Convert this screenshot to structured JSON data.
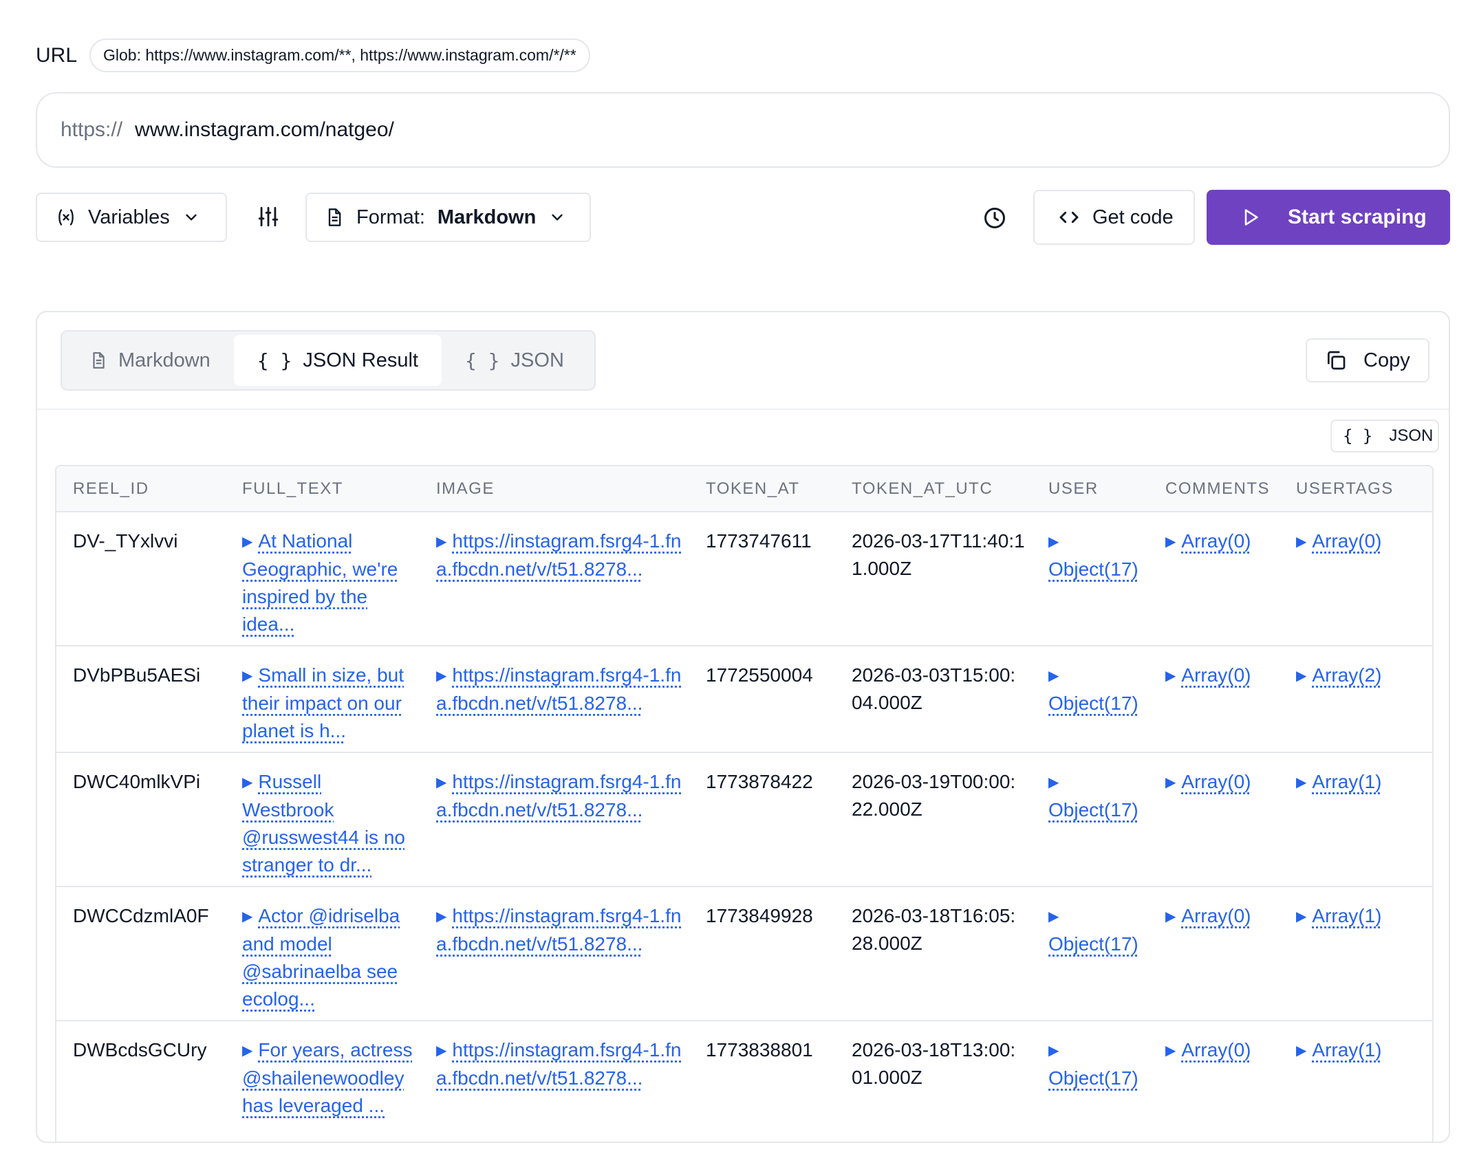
{
  "url_section": {
    "label": "URL",
    "glob": "Glob: https://www.instagram.com/**, https://www.instagram.com/*/**",
    "prefix": "https://",
    "value": "www.instagram.com/natgeo/"
  },
  "toolbar": {
    "variables_label": "Variables",
    "format_prefix": "Format:",
    "format_value": "Markdown",
    "get_code_label": "Get code",
    "start_label": "Start scraping",
    "accent_color": "#6f42c1"
  },
  "result_panel": {
    "tabs": [
      {
        "label": "Markdown",
        "icon": "document-icon",
        "active": false
      },
      {
        "label": "JSON Result",
        "icon": "braces-icon",
        "active": true
      },
      {
        "label": "JSON",
        "icon": "braces-icon",
        "active": false
      }
    ],
    "copy_label": "Copy",
    "json_badge": "JSON"
  },
  "table": {
    "columns": [
      "REEL_ID",
      "FULL_TEXT",
      "IMAGE",
      "TOKEN_AT",
      "TOKEN_AT_UTC",
      "USER",
      "COMMENTS",
      "USERTAGS"
    ],
    "rows": [
      {
        "reel_id": "DV-_TYxlvvi",
        "full_text": "At National Geographic, we're inspired by the idea...",
        "image": "https://instagram.fsrg4-1.fna.fbcdn.net/v/t51.8278...",
        "token_at": "1773747611",
        "token_at_utc": "2026-03-17T11:40:11.000Z",
        "user": "Object(17)",
        "comments": "Array(0)",
        "usertags": "Array(0)"
      },
      {
        "reel_id": "DVbPBu5AESi",
        "full_text": "Small in size, but their impact on our planet is h...",
        "image": "https://instagram.fsrg4-1.fna.fbcdn.net/v/t51.8278...",
        "token_at": "1772550004",
        "token_at_utc": "2026-03-03T15:00:04.000Z",
        "user": "Object(17)",
        "comments": "Array(0)",
        "usertags": "Array(2)"
      },
      {
        "reel_id": "DWC40mlkVPi",
        "full_text": "Russell Westbrook @russwest44 is no stranger to dr...",
        "image": "https://instagram.fsrg4-1.fna.fbcdn.net/v/t51.8278...",
        "token_at": "1773878422",
        "token_at_utc": "2026-03-19T00:00:22.000Z",
        "user": "Object(17)",
        "comments": "Array(0)",
        "usertags": "Array(1)"
      },
      {
        "reel_id": "DWCCdzmlA0F",
        "full_text": "Actor @idriselba and model @sabrinaelba see ecolog...",
        "image": "https://instagram.fsrg4-1.fna.fbcdn.net/v/t51.8278...",
        "token_at": "1773849928",
        "token_at_utc": "2026-03-18T16:05:28.000Z",
        "user": "Object(17)",
        "comments": "Array(0)",
        "usertags": "Array(1)"
      },
      {
        "reel_id": "DWBcdsGCUry",
        "full_text": "For years, actress @shailenewoodley has leveraged ...",
        "image": "https://instagram.fsrg4-1.fna.fbcdn.net/v/t51.8278...",
        "token_at": "1773838801",
        "token_at_utc": "2026-03-18T13:00:01.000Z",
        "user": "Object(17)",
        "comments": "Array(0)",
        "usertags": "Array(1)"
      }
    ]
  }
}
